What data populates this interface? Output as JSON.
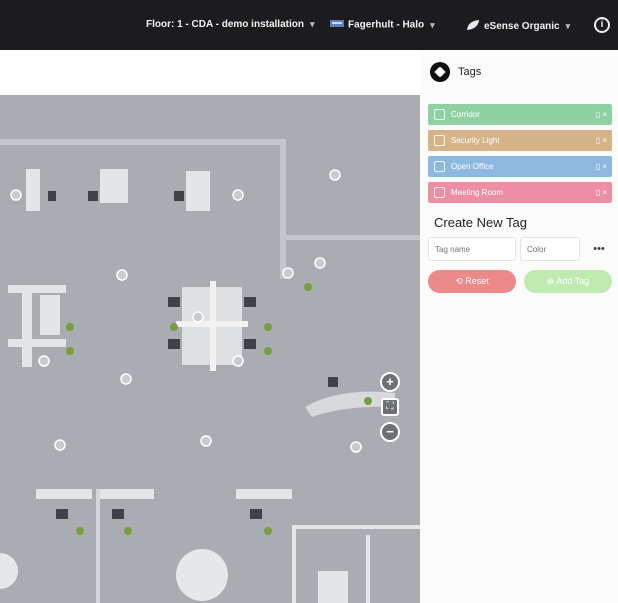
{
  "topbar": {
    "floor": "Floor: 1 - CDA - demo installation",
    "luminaire": "Fagerhult - Halo",
    "organization": "eSense Organic",
    "info_icon": "info-icon",
    "caret_icon": "chevron-down-icon"
  },
  "tags": {
    "title": "Tags",
    "header_icon": "tag-icon",
    "items": [
      {
        "label": "Corridor",
        "color": "#8fd1a3"
      },
      {
        "label": "Security Light",
        "color": "#d6b48a"
      },
      {
        "label": "Open Office",
        "color": "#8eb8e0"
      },
      {
        "label": "Meeting Room",
        "color": "#ec8fa2"
      }
    ],
    "create_title": "Create New Tag",
    "name_placeholder": "Tag name",
    "color_placeholder": "Color",
    "reset_label": "Reset",
    "add_label": "Add Tag",
    "reset_color": "#ec8a8a",
    "add_color": "#bfeab0"
  },
  "map": {
    "floor_color": "#a9acb1",
    "sensor_color": "#7a9e3f",
    "zoom_in_icon": "zoom-in-icon",
    "fit_icon": "fit-screen-icon",
    "zoom_out_icon": "zoom-out-icon"
  }
}
